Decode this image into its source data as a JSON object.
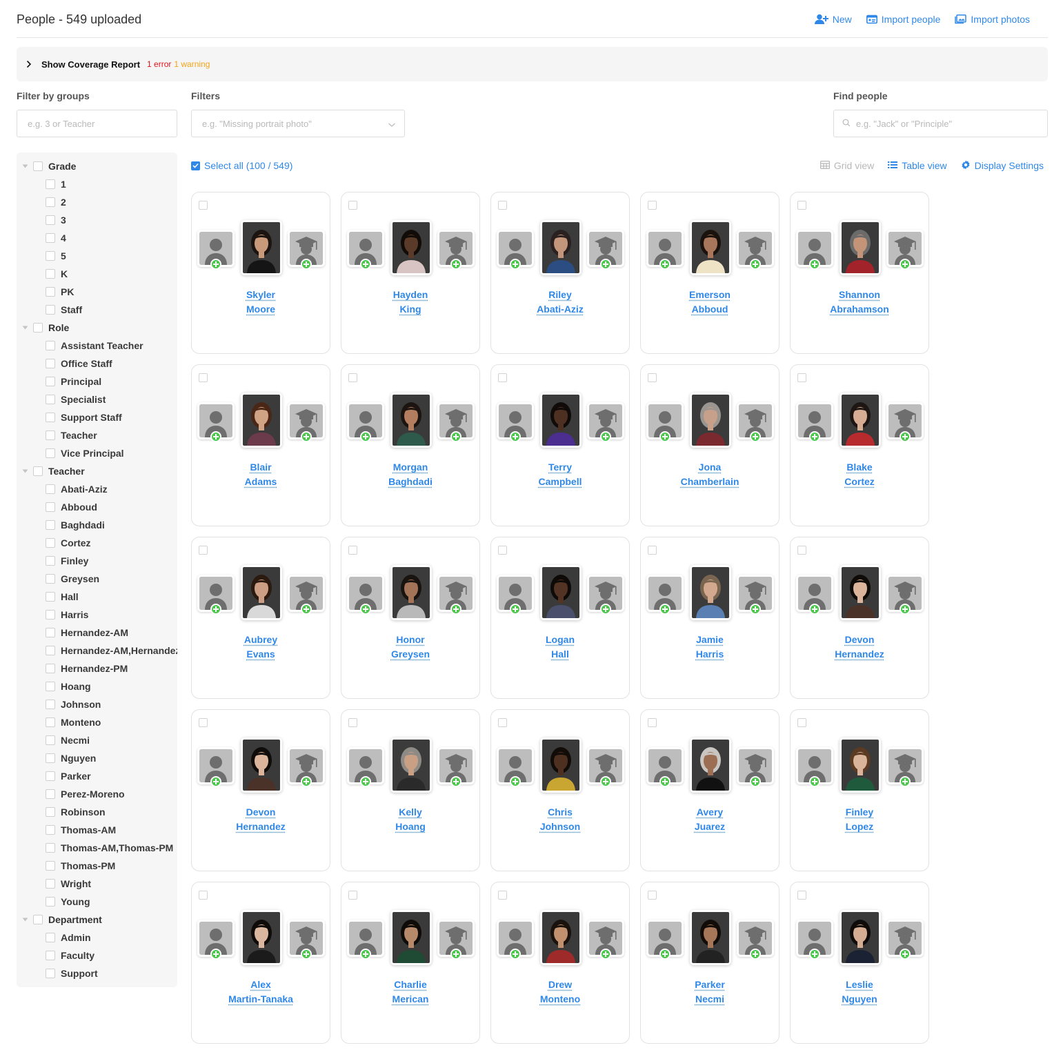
{
  "header": {
    "title": "People - 549 uploaded",
    "actions": [
      {
        "label": "New",
        "icon": "user-plus-icon"
      },
      {
        "label": "Import people",
        "icon": "id-card-icon"
      },
      {
        "label": "Import photos",
        "icon": "images-icon"
      }
    ]
  },
  "coverage": {
    "title": "Show Coverage Report",
    "error_text": "1 error",
    "warning_text": "1 warning"
  },
  "filters": {
    "groups_label": "Filter by groups",
    "groups_placeholder": "e.g. 3 or Teacher",
    "filters_label": "Filters",
    "filters_placeholder": "e.g. \"Missing portrait photo\"",
    "find_label": "Find people",
    "find_placeholder": "e.g. \"Jack\" or \"Principle\""
  },
  "sidebar": {
    "groups": [
      {
        "label": "Grade",
        "items": [
          "1",
          "2",
          "3",
          "4",
          "5",
          "K",
          "PK",
          "Staff"
        ]
      },
      {
        "label": "Role",
        "items": [
          "Assistant Teacher",
          "Office Staff",
          "Principal",
          "Specialist",
          "Support Staff",
          "Teacher",
          "Vice Principal"
        ]
      },
      {
        "label": "Teacher",
        "items": [
          "Abati-Aziz",
          "Abboud",
          "Baghdadi",
          "Cortez",
          "Finley",
          "Greysen",
          "Hall",
          "Harris",
          "Hernandez-AM",
          "Hernandez-AM,Hernandez-PM",
          "Hernandez-PM",
          "Hoang",
          "Johnson",
          "Monteno",
          "Necmi",
          "Nguyen",
          "Parker",
          "Perez-Moreno",
          "Robinson",
          "Thomas-AM",
          "Thomas-AM,Thomas-PM",
          "Thomas-PM",
          "Wright",
          "Young"
        ]
      },
      {
        "label": "Department",
        "items": [
          "Admin",
          "Faculty",
          "Support"
        ]
      }
    ]
  },
  "toolbar": {
    "select_all": "Select all (100 / 549)",
    "grid_view": "Grid view",
    "table_view": "Table view",
    "display_settings": "Display Settings"
  },
  "colors": {
    "accent": "#2f88e8",
    "error": "#e0151d",
    "warning": "#f0a417",
    "add": "#4cc84c"
  },
  "people": [
    {
      "first": "Skyler",
      "last": "Moore",
      "bg": "#3b3b3b",
      "skin": "#c99a7a",
      "hair": "#1c1410",
      "shirt": "#151515"
    },
    {
      "first": "Hayden",
      "last": "King",
      "bg": "#3a3a3a",
      "skin": "#5a3a28",
      "hair": "#120c08",
      "shirt": "#d9c4c4"
    },
    {
      "first": "Riley",
      "last": "Abati-Aziz",
      "bg": "#3b3b3b",
      "skin": "#c3967c",
      "hair": "#2a2020",
      "shirt": "#2c4d82"
    },
    {
      "first": "Emerson",
      "last": "Abboud",
      "bg": "#3c3c3c",
      "skin": "#a8765a",
      "hair": "#1a120c",
      "shirt": "#efe3c6"
    },
    {
      "first": "Shannon",
      "last": "Abrahamson",
      "bg": "#3a3a3a",
      "skin": "#c49478",
      "hair": "#6b6b6b",
      "shirt": "#a3232a"
    },
    {
      "first": "Blair",
      "last": "Adams",
      "bg": "#3b3b3b",
      "skin": "#d1a385",
      "hair": "#4a2616",
      "shirt": "#6b3a4b"
    },
    {
      "first": "Morgan",
      "last": "Baghdadi",
      "bg": "#3a3a3a",
      "skin": "#b27e5f",
      "hair": "#1c1410",
      "shirt": "#2e5a4c"
    },
    {
      "first": "Terry",
      "last": "Campbell",
      "bg": "#3b3b3b",
      "skin": "#4d3022",
      "hair": "#100a08",
      "shirt": "#4b2e8f"
    },
    {
      "first": "Jona",
      "last": "Chamberlain",
      "bg": "#3b3b3b",
      "skin": "#c7a08a",
      "hair": "#9a9590",
      "shirt": "#7a2a2e"
    },
    {
      "first": "Blake",
      "last": "Cortez",
      "bg": "#3a3a3a",
      "skin": "#d6ad93",
      "hair": "#1e1612",
      "shirt": "#b72a2e"
    },
    {
      "first": "Aubrey",
      "last": "Evans",
      "bg": "#3a3a3a",
      "skin": "#cc9f84",
      "hair": "#2b1a10",
      "shirt": "#d9d9d9"
    },
    {
      "first": "Honor",
      "last": "Greysen",
      "bg": "#3b3b3b",
      "skin": "#a47459",
      "hair": "#1a1410",
      "shirt": "#b9b9b9"
    },
    {
      "first": "Logan",
      "last": "Hall",
      "bg": "#3a3a3a",
      "skin": "#523324",
      "hair": "#0e0a08",
      "shirt": "#4a4f6b"
    },
    {
      "first": "Jamie",
      "last": "Harris",
      "bg": "#3b3b3b",
      "skin": "#d2a98e",
      "hair": "#7a6550",
      "shirt": "#5a7fb3"
    },
    {
      "first": "Devon",
      "last": "Hernandez",
      "bg": "#3a3a3a",
      "skin": "#dbb59b",
      "hair": "#0f0b09",
      "shirt": "#4a3228"
    },
    {
      "first": "Devon",
      "last": "Hernandez",
      "bg": "#3a3a3a",
      "skin": "#dbb59b",
      "hair": "#0f0b09",
      "shirt": "#4a3228"
    },
    {
      "first": "Kelly",
      "last": "Hoang",
      "bg": "#3b3b3b",
      "skin": "#c9a084",
      "hair": "#8e8a86",
      "shirt": "#2a2a2a"
    },
    {
      "first": "Chris",
      "last": "Johnson",
      "bg": "#3a3a3a",
      "skin": "#4e3021",
      "hair": "#120c08",
      "shirt": "#c9a531"
    },
    {
      "first": "Avery",
      "last": "Juarez",
      "bg": "#3b3b3b",
      "skin": "#9c6f55",
      "hair": "#c9c5c0",
      "shirt": "#111111"
    },
    {
      "first": "Finley",
      "last": "Lopez",
      "bg": "#3a3a3a",
      "skin": "#d9b39a",
      "hair": "#5a3a22",
      "shirt": "#1f5a3c"
    },
    {
      "first": "Alex",
      "last": "Martin-Tanaka",
      "bg": "#3b3b3b",
      "skin": "#dcb79f",
      "hair": "#0f0b09",
      "shirt": "#1b1b1b"
    },
    {
      "first": "Charlie",
      "last": "Merican",
      "bg": "#3a3a3a",
      "skin": "#b7896b",
      "hair": "#0f0b09",
      "shirt": "#1f4a33"
    },
    {
      "first": "Drew",
      "last": "Monteno",
      "bg": "#3b3b3b",
      "skin": "#c0906f",
      "hair": "#1a120c",
      "shirt": "#9e2a2a"
    },
    {
      "first": "Parker",
      "last": "Necmi",
      "bg": "#3a3a3a",
      "skin": "#a67659",
      "hair": "#120c08",
      "shirt": "#222222"
    },
    {
      "first": "Leslie",
      "last": "Nguyen",
      "bg": "#3a3a3a",
      "skin": "#d5ad92",
      "hair": "#0f0b09",
      "shirt": "#1b2234"
    }
  ]
}
